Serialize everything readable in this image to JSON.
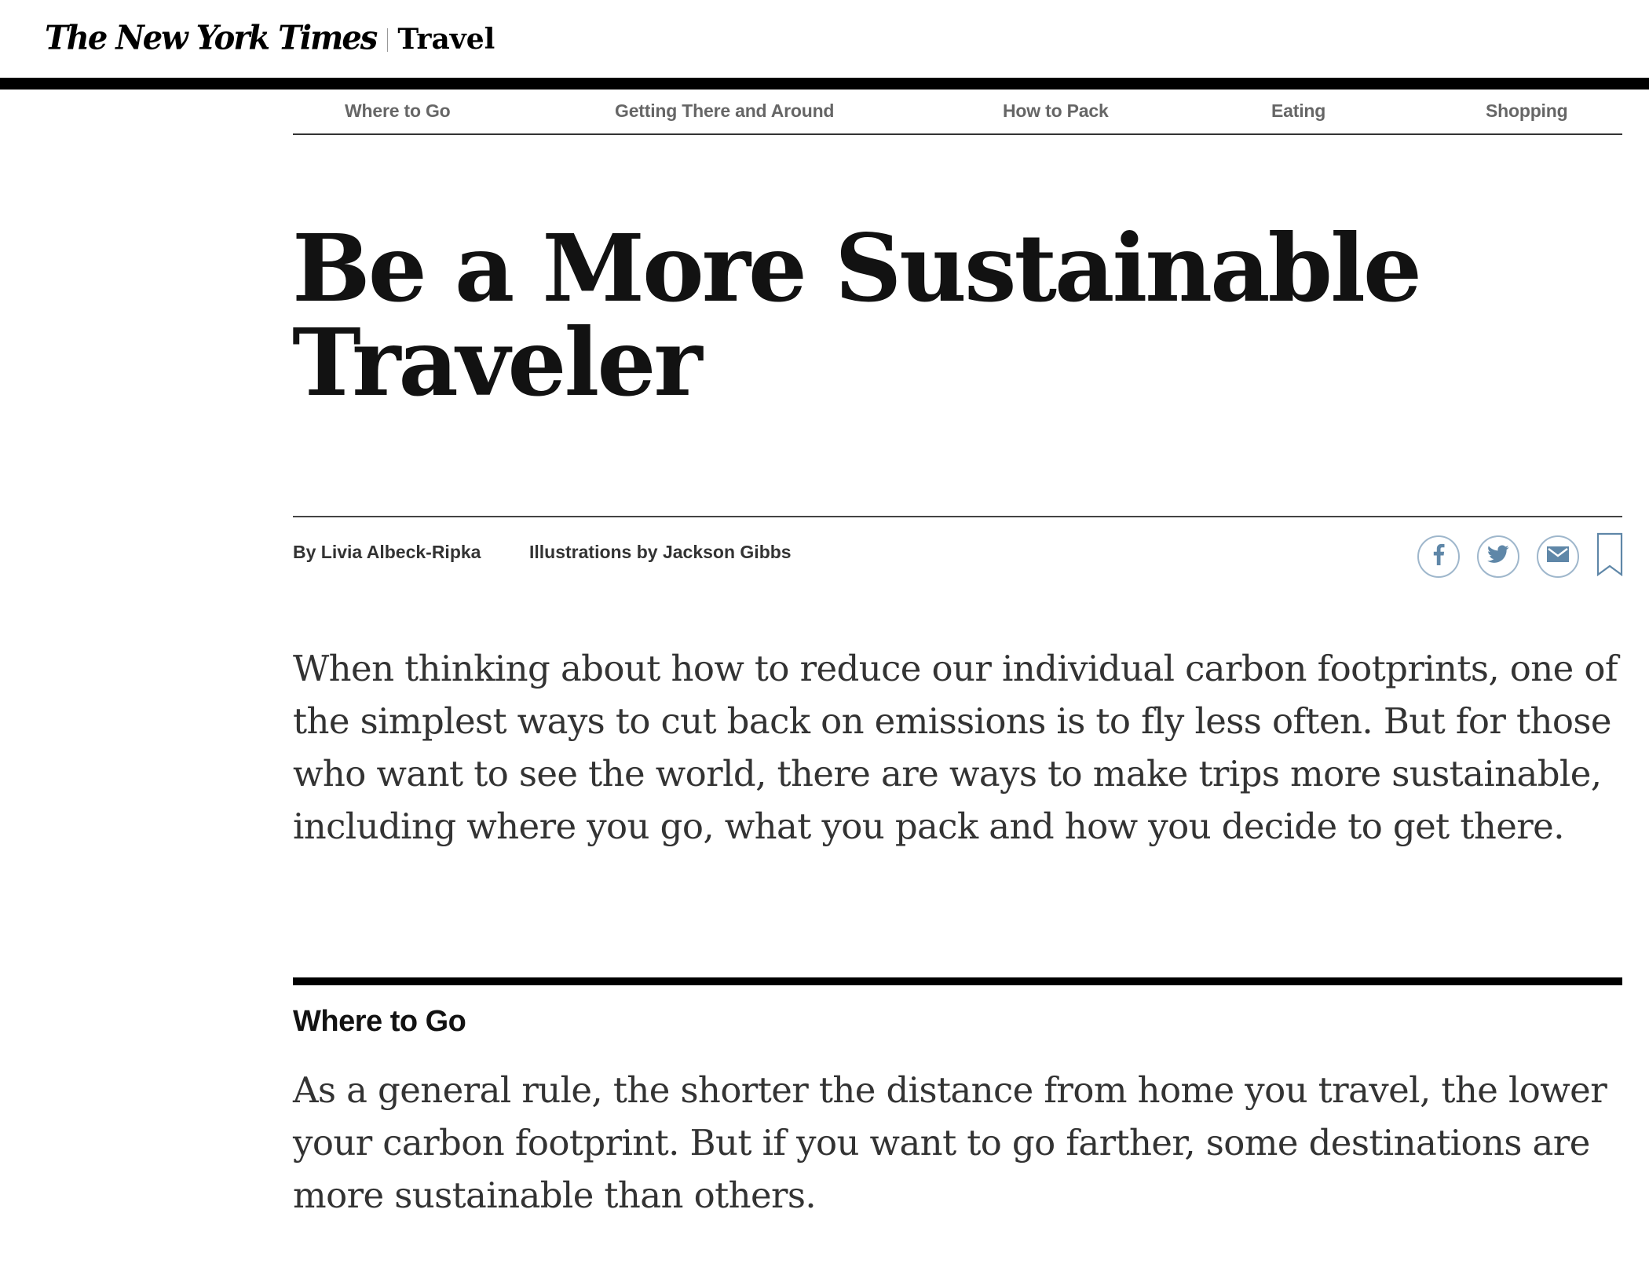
{
  "masthead": {
    "publication": "The New York Times",
    "section": "Travel"
  },
  "nav": {
    "items": [
      {
        "label": "Where to Go"
      },
      {
        "label": "Getting There and Around"
      },
      {
        "label": "How to Pack"
      },
      {
        "label": "Eating"
      },
      {
        "label": "Shopping"
      }
    ]
  },
  "article": {
    "headline": "Be a More Sustainable Traveler",
    "byline": "By Livia Albeck-Ripka",
    "illustrations": "Illustrations by Jackson Gibbs",
    "share": {
      "icons": [
        "facebook-icon",
        "twitter-icon",
        "email-icon",
        "bookmark-icon"
      ],
      "icon_color": "#5f87a8",
      "ring_color": "#9fb7cc"
    },
    "lead": "When thinking about how to reduce our individual carbon footprints, one of the simplest ways to cut back on emissions is to fly less often. But for those who want to see the world, there are ways to make trips more sustainable, including where you go, what you pack and how you decide to get there.",
    "sections": [
      {
        "heading": "Where to Go",
        "body": "As a general rule, the shorter the distance from home you travel, the lower your carbon footprint. But if you want to go farther, some destinations are more sustainable than others."
      }
    ]
  },
  "colors": {
    "text_primary": "#121212",
    "text_body": "#333333",
    "nav_text": "#666666",
    "rule": "#000000"
  }
}
